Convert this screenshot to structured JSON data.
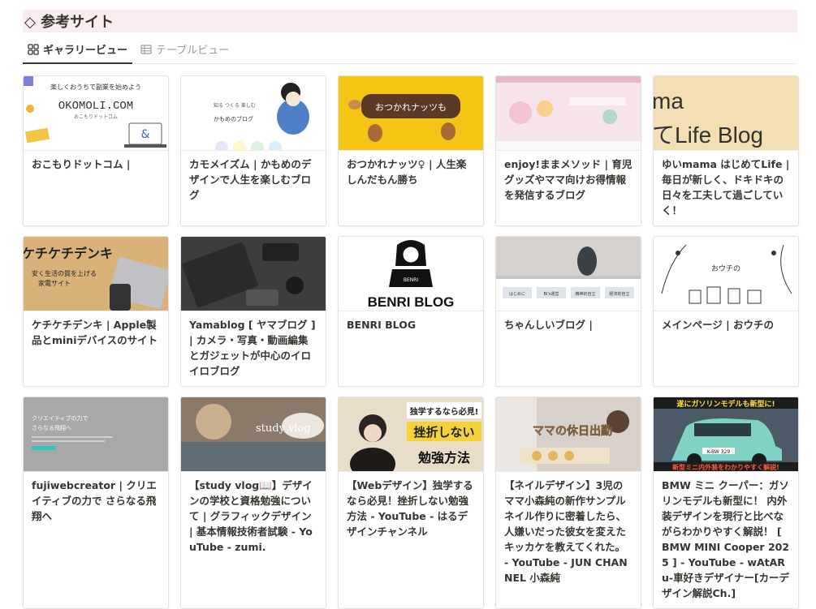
{
  "header": {
    "title": "◇ 参考サイト"
  },
  "tabs": [
    {
      "label": "ギャラリービュー",
      "icon": "grid-icon",
      "active": true
    },
    {
      "label": "テーブルビュー",
      "icon": "table-icon",
      "active": false
    }
  ],
  "cards": [
    {
      "title": "おこもりドットコム |",
      "thumb_text": [
        "楽しくおうちで副業を始めよう",
        "OKOMOLI.COM",
        "おこもりドットコム"
      ]
    },
    {
      "title": "カモメイズム | かもめのデザインで人生を楽しむブログ",
      "thumb_text": [
        "知る つくる 楽しむ",
        "かもめのブログ"
      ]
    },
    {
      "title": "おつかれナッツ♀ | 人生楽しんだもん勝ち",
      "thumb_text": [
        "おつかれナッツも"
      ]
    },
    {
      "title": "enjoy!ままメソッド | 育児グッズやママ向けお得情報を発信するブログ",
      "thumb_text": []
    },
    {
      "title": "ゆいmama はじめてLife | 毎日が新しく、ドキドキの日々を工夫して過ごしていく！",
      "thumb_text": [
        "ma",
        "てLife Blog"
      ]
    },
    {
      "title": "ケチケチデンキ | Apple製品とminiデバイスのサイト",
      "thumb_text": [
        "ケチケチデンキ",
        "安く生活の質を上げる",
        "家電サイト"
      ]
    },
    {
      "title": "Yamablog [ ヤマブログ ] | カメラ・写真・動画編集とガジェットが中心のイロイロブログ",
      "thumb_text": []
    },
    {
      "title": "BENRI BLOG",
      "thumb_text": [
        "BENRI",
        "BENRI BLOG"
      ]
    },
    {
      "title": "ちゃんしいブログ |",
      "thumb_text": [
        "はじめに",
        "BI's運営",
        "精神的自立",
        "経済的自立"
      ]
    },
    {
      "title": "メインページ | おウチの",
      "thumb_text": [
        "おウチの"
      ]
    },
    {
      "title": "fujiwebcreator | クリエイティブの力で さらなる飛翔へ",
      "thumb_text": [
        "クリエイティブの力で",
        "さらなる飛翔へ"
      ]
    },
    {
      "title": "【study vlog📖】デザインの学校と資格勉強について | グラフィックデザイン | 基本情報技術者試験 - YouTube - zumi.",
      "thumb_text": [
        "study vlog"
      ]
    },
    {
      "title": "【Webデザイン】独学するなら必見！挫折しない勉強方法 - YouTube - はるデザインチャンネル",
      "thumb_text": [
        "独学するなら必見!",
        "挫折しない",
        "勉強方法"
      ]
    },
    {
      "title": "【ネイルデザイン】3児のママ小森純の新作サンプルネイル作りに密着したら、人嫌いだった彼女を変えたキッカケを教えてくれた。 - YouTube - JUN CHANNEL 小森純",
      "thumb_text": [
        "ママの休日出勤"
      ]
    },
    {
      "title": "BMW ミニ クーパー：ガソリンモデルも新型に！ 内外装デザインを現行と比べながらわかりやすく解説！ [ BMW MINI Cooper 2025 ] - YouTube - wAtARu-車好きデザイナー[カーデザイン解説Ch.]",
      "thumb_text": [
        "遂にガソリンモデルも新型に!",
        "新型ミニ内外装をわかりやすく解説!",
        "K-BW 329"
      ]
    }
  ],
  "colors": {
    "header_bg": "#fbecf0",
    "border": "#e3e2e0",
    "text": "#37352f",
    "muted": "#9b9a97"
  }
}
